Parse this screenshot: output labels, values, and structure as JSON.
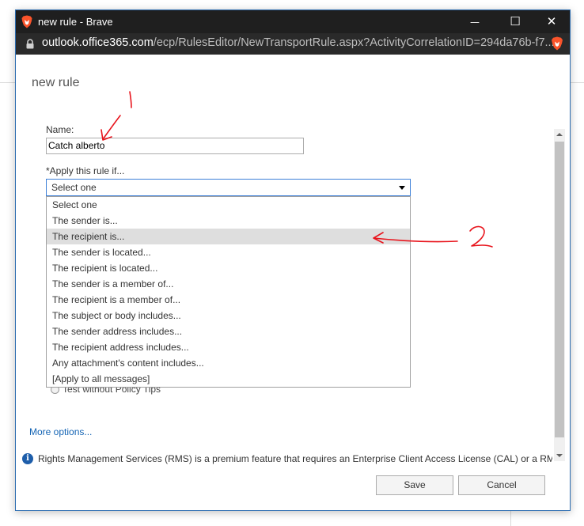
{
  "browser": {
    "window_title": "new rule - Brave",
    "url_host": "outlook.office365.com",
    "url_path": "/ecp/RulesEditor/NewTransportRule.aspx?ActivityCorrelationID=294da76b-f7...",
    "controls": {
      "minimize": "—",
      "maximize": "☐",
      "close": "✕"
    }
  },
  "dialog": {
    "title": "new rule",
    "name_label": "Name:",
    "name_value": "Catch alberto",
    "apply_label": "*Apply this rule if...",
    "condition_selected": "Select one",
    "condition_options": [
      "Select one",
      "The sender is...",
      "The recipient is...",
      "The sender is located...",
      "The recipient is located...",
      "The sender is a member of...",
      "The recipient is a member of...",
      "The subject or body includes...",
      "The sender address includes...",
      "The recipient address includes...",
      "Any attachment's content includes...",
      "[Apply to all messages]"
    ],
    "highlighted_option": "The recipient is...",
    "partial_radio_label": "Test without Policy Tips",
    "more_options": "More options...",
    "info_text": "Rights Management Services (RMS) is a premium feature that requires an Enterprise Client Access License (CAL) or a RMS",
    "save_label": "Save",
    "cancel_label": "Cancel"
  },
  "annotations": {
    "marker_1": "1",
    "marker_2": "2",
    "ink_color": "#e8141c"
  },
  "icons": {
    "browser_logo": "brave-lion-icon",
    "lock": "lock-icon",
    "shield": "brave-shield-icon",
    "info": "info-icon",
    "dropdown": "chevron-down-icon"
  }
}
